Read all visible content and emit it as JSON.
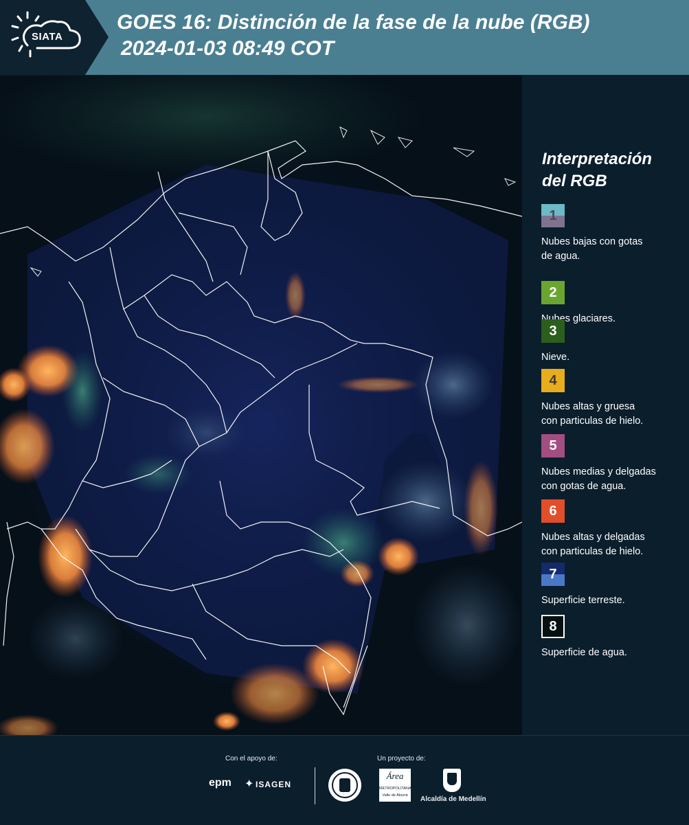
{
  "header": {
    "logo_text": "SIATA",
    "title_line1": "GOES 16: Distinción de la fase de la nube (RGB)",
    "title_line2": "2024-01-03 08:49 COT"
  },
  "legend": {
    "title_line1": "Interpretación",
    "title_line2": "del RGB",
    "items": [
      {
        "num": "1",
        "line1": "Nubes bajas con gotas",
        "line2": "de agua.",
        "color_top": "#6cb9c7",
        "color_bottom": "#7f7390",
        "text_color": "#4a4a5a"
      },
      {
        "num": "2",
        "line1": "Nubes glaciares.",
        "line2": "",
        "color_top": "#6aa62f",
        "color_bottom": "#6aa62f",
        "text_color": "#ffffff"
      },
      {
        "num": "3",
        "line1": "Nieve.",
        "line2": "",
        "color_top": "#2c5e1e",
        "color_bottom": "#2c5e1e",
        "text_color": "#ffffff"
      },
      {
        "num": "4",
        "line1": "Nubes altas y gruesa",
        "line2": "con particulas de hielo.",
        "color_top": "#e7ad1c",
        "color_bottom": "#e7ad1c",
        "text_color": "#3a3a3a"
      },
      {
        "num": "5",
        "line1": "Nubes medias y delgadas",
        "line2": "con gotas de agua.",
        "color_top": "#a34e83",
        "color_bottom": "#a34e83",
        "text_color": "#ffffff"
      },
      {
        "num": "6",
        "line1": "Nubes altas y delgadas",
        "line2": "con particulas de hielo.",
        "color_top": "#e14e2a",
        "color_bottom": "#e14e2a",
        "text_color": "#ffffff"
      },
      {
        "num": "7",
        "line1": "Superficie terreste.",
        "line2": "",
        "color_top": "#142a6a",
        "color_bottom": "#4a78c8",
        "text_color": "#ffffff"
      },
      {
        "num": "8",
        "line1": "Superficie de agua.",
        "line2": "",
        "color_top": "#071010",
        "color_bottom": "#071010",
        "text_color": "#ffffff"
      }
    ]
  },
  "footer": {
    "support_label": "Con el apoyo de:",
    "project_label": "Un proyecto de:",
    "sponsor_epm": "epm",
    "sponsor_isagen": "ISAGEN",
    "area_label": "Área",
    "area_sub1": "METROPOLITANA",
    "area_sub2": "Valle de Aburrá",
    "alcaldia": "Alcaldía de Medellín"
  },
  "map_icon": "satellite-rgb-image"
}
